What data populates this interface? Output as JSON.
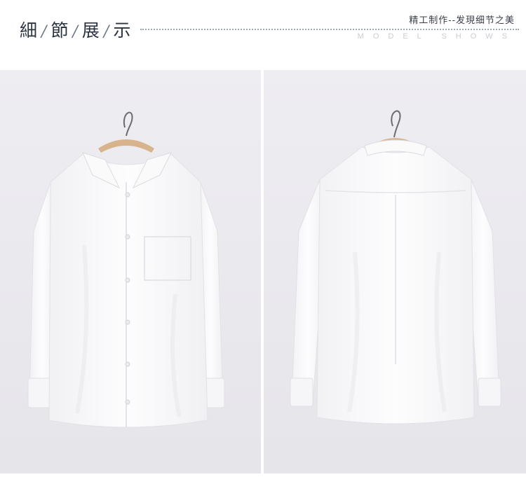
{
  "header": {
    "title_chars": [
      "細",
      "節",
      "展",
      "示"
    ],
    "tagline": "精工制作--发現细节之美",
    "subtitle": "MODEL SHOWS"
  },
  "photos": [
    {
      "view": "front",
      "subject": "white-shirt-on-hanger"
    },
    {
      "view": "back",
      "subject": "white-shirt-on-hanger"
    }
  ],
  "colors": {
    "background": "#ffffff",
    "photo_backdrop": "#ecebf0",
    "shirt": "#fbfbfc",
    "title_text": "#2b3440",
    "dots": "#9aa6b4"
  }
}
